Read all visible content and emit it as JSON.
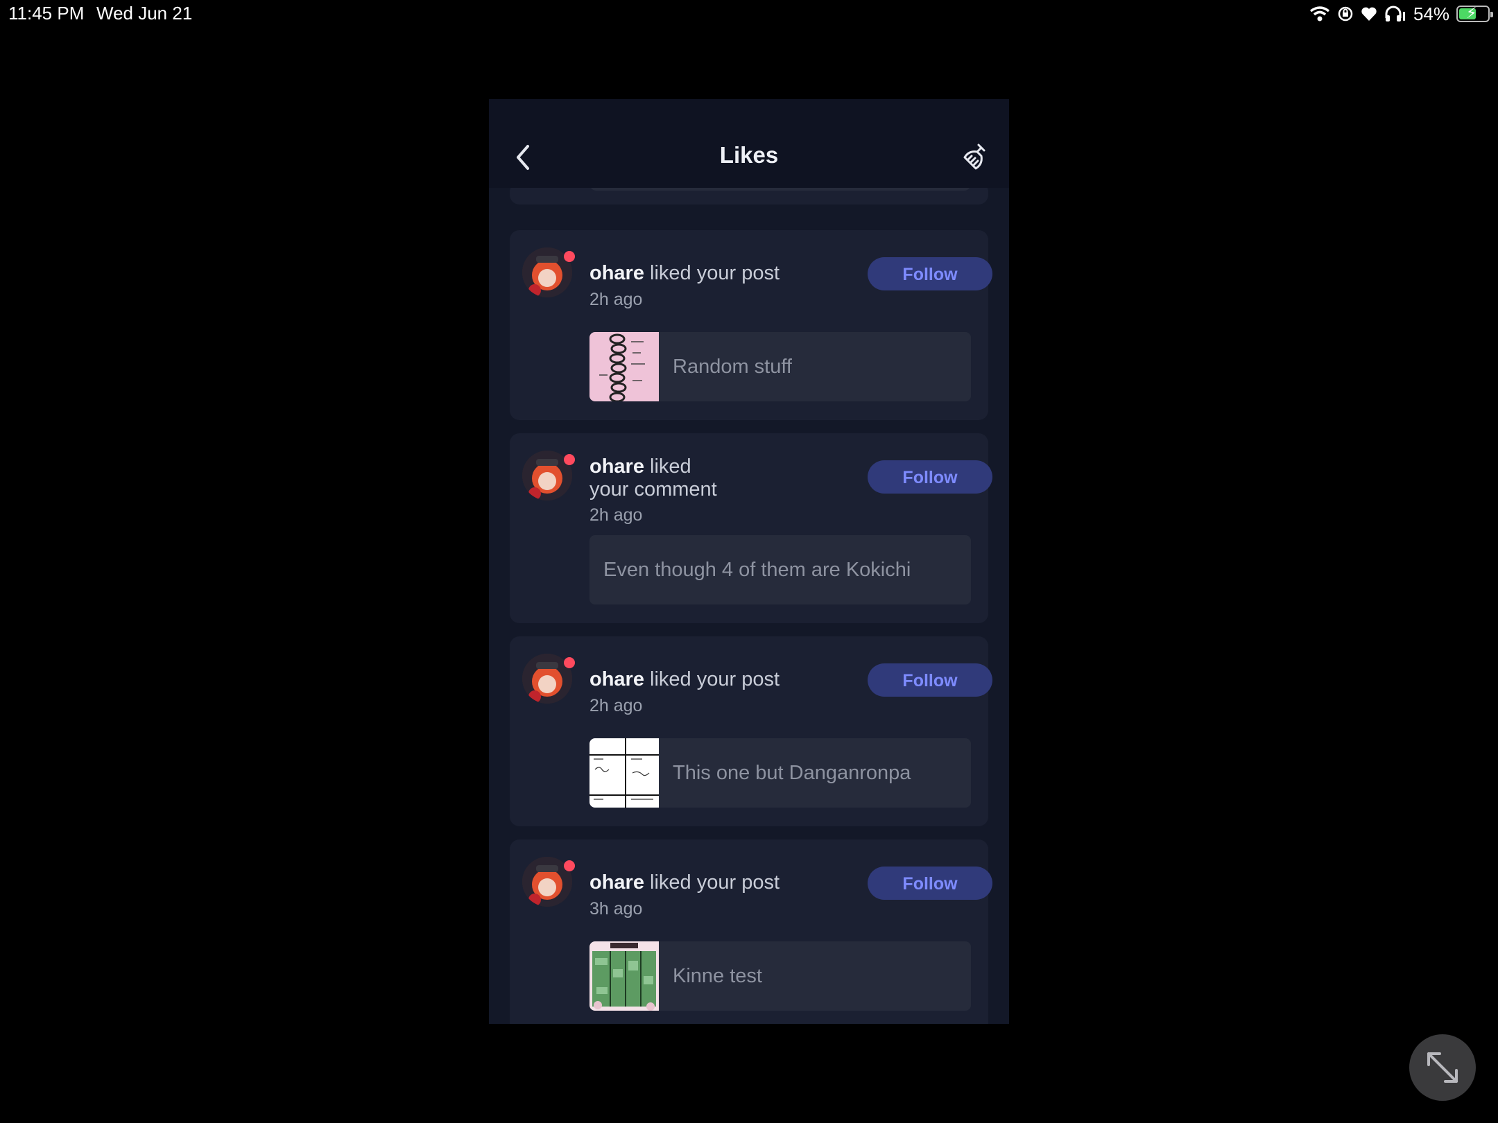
{
  "status_bar": {
    "time": "11:45 PM",
    "date": "Wed Jun 21",
    "battery_percent": "54%",
    "icons": [
      "wifi-icon",
      "screen-lock-icon",
      "heart-icon",
      "headphones-icon",
      "battery-icon"
    ]
  },
  "header": {
    "title": "Likes",
    "back_icon": "chevron-left-icon",
    "clear_icon": "brush-icon"
  },
  "notifications": [
    {
      "user": "ohare",
      "action": "liked your post",
      "time": "2h ago",
      "follow_label": "Follow",
      "preview_text": "Random stuff",
      "preview_type": "post"
    },
    {
      "user": "ohare",
      "action": "liked your comment",
      "action_line1": "liked",
      "action_line2": "your comment",
      "time": "2h ago",
      "follow_label": "Follow",
      "preview_text": "Even though 4 of them are Kokichi",
      "preview_type": "comment"
    },
    {
      "user": "ohare",
      "action": "liked your post",
      "time": "2h ago",
      "follow_label": "Follow",
      "preview_text": "This one but Danganronpa",
      "preview_type": "post"
    },
    {
      "user": "ohare",
      "action": "liked your post",
      "time": "3h ago",
      "follow_label": "Follow",
      "preview_text": "Kinne test",
      "preview_type": "post"
    }
  ],
  "colors": {
    "background": "#000000",
    "panel": "#131828",
    "card": "#1b2032",
    "follow_bg": "#303a7a",
    "follow_text": "#7e8bff",
    "avatar_dot": "#ff4a5e"
  },
  "overlay": {
    "expand_icon": "expand-arrows-icon"
  }
}
